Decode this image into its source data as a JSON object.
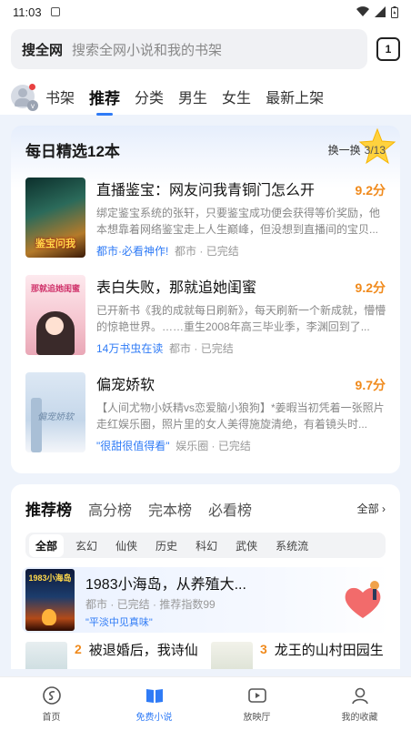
{
  "status": {
    "time": "11:03"
  },
  "search": {
    "brand": "搜全网",
    "placeholder": "搜索全网小说和我的书架",
    "tab_count": "1"
  },
  "nav": {
    "tabs": [
      {
        "label": "书架"
      },
      {
        "label": "推荐"
      },
      {
        "label": "分类"
      },
      {
        "label": "男生"
      },
      {
        "label": "女生"
      },
      {
        "label": "最新上架"
      }
    ],
    "active": "推荐",
    "avatar_badge": "v"
  },
  "daily": {
    "title": "每日精选12本",
    "swap_label": "换一换",
    "page": "3/13",
    "books": [
      {
        "cover_text": "鉴宝问我",
        "title": "直播鉴宝：网友问我青铜门怎么开",
        "score": "9.2分",
        "desc": "绑定鉴宝系统的张轩，只要鉴宝成功便会获得等价奖励，他本想靠着网络鉴宝走上人生巅峰，但没想到直播间的宝贝...",
        "tag": "都市·必看神作!",
        "category": "都市",
        "status": "已完结"
      },
      {
        "cover_text": "那就追她闺蜜",
        "title": "表白失败，那就追她闺蜜",
        "score": "9.2分",
        "desc": "已开新书《我的成就每日刷新》，每天刷新一个新成就，懵懵的惊艳世界。……重生2008年高三毕业季，李渊回到了...",
        "tag": "14万书虫在读",
        "category": "都市",
        "status": "已完结"
      },
      {
        "cover_text": "偏宠娇软",
        "title": "偏宠娇软",
        "score": "9.7分",
        "desc": "【人间尤物小妖精vs恋爱脑小狼狗】*姜暇当初凭着一张照片走红娱乐圈，照片里的女人美得施旋清绝，有着镜头时...",
        "tag": "\"很甜很值得看\"",
        "category": "娱乐圈",
        "status": "已完结"
      }
    ]
  },
  "ranking": {
    "tabs": [
      {
        "label": "推荐榜"
      },
      {
        "label": "高分榜"
      },
      {
        "label": "完本榜"
      },
      {
        "label": "必看榜"
      }
    ],
    "all_label": "全部 ›",
    "chips": [
      "全部",
      "玄幻",
      "仙侠",
      "历史",
      "科幻",
      "武侠",
      "系统流"
    ],
    "top": {
      "cover_text": "1983小海岛",
      "title": "1983小海岛，从养殖大...",
      "meta": "都市 · 已完结 · 推荐指数99",
      "tag": "\"平淡中见真味\""
    },
    "items": [
      {
        "num": "2",
        "title": "被退婚后，我诗仙"
      },
      {
        "num": "3",
        "title": "龙王的山村田园生"
      }
    ]
  },
  "bottom_bar": [
    {
      "label": "首页",
      "icon": "home-icon"
    },
    {
      "label": "免费小说",
      "icon": "book-icon"
    },
    {
      "label": "放映厅",
      "icon": "play-icon"
    },
    {
      "label": "我的收藏",
      "icon": "user-icon"
    }
  ],
  "colors": {
    "accent": "#2f7bf6",
    "score": "#f08a1c"
  }
}
